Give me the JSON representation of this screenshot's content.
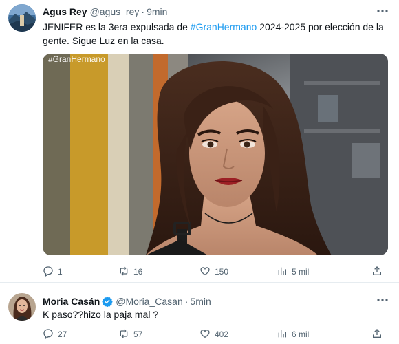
{
  "tweets": [
    {
      "author": {
        "name": "Agus Rey",
        "handle": "@agus_rey",
        "time": "9min",
        "avatar": "avatar-landscape-photo"
      },
      "text_before": "JENIFER es la 3era expulsada de ",
      "hashtag": "#GranHermano",
      "text_after": " 2024-2025 por elección de la gente. Sigue Luz en la casa.",
      "media": {
        "overlay_tag": "#GranHermano",
        "description_icon": "photo-woman-portrait"
      },
      "actions": {
        "replies": "1",
        "retweets": "16",
        "likes": "150",
        "views": "5 mil"
      }
    },
    {
      "author": {
        "name": "Moria Casán",
        "handle": "@Moria_Casan",
        "time": "5min",
        "verified": true,
        "avatar": "avatar-woman-photo"
      },
      "text": "K paso??hizo la paja mal ?",
      "actions": {
        "replies": "27",
        "retweets": "57",
        "likes": "402",
        "views": "6 mil"
      }
    }
  ],
  "separator": "·",
  "colors": {
    "accent": "#1d9bf0",
    "text_primary": "#0f1419",
    "text_secondary": "#536471",
    "divider": "#e6ecf0"
  },
  "icons": [
    "reply-icon",
    "retweet-icon",
    "like-icon",
    "views-icon",
    "share-icon",
    "more-icon",
    "verified-icon"
  ]
}
